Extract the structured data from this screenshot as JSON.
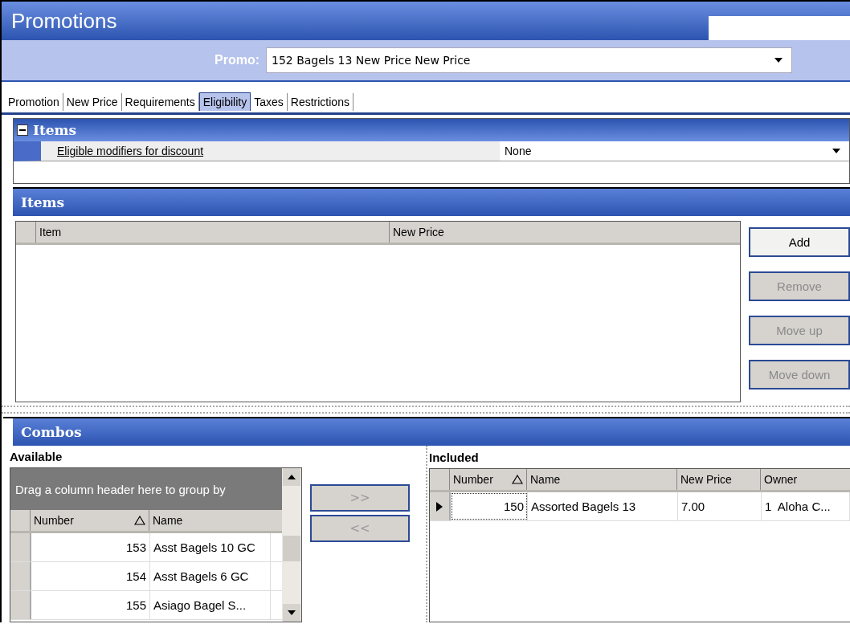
{
  "window": {
    "title": "Promotions"
  },
  "promo": {
    "label": "Promo:",
    "value": "152 Bagels 13 New Price New Price"
  },
  "tabs": [
    {
      "label": "Promotion",
      "selected": false
    },
    {
      "label": "New Price",
      "selected": false
    },
    {
      "label": "Requirements",
      "selected": false
    },
    {
      "label": "Eligibility",
      "selected": true
    },
    {
      "label": "Taxes",
      "selected": false
    },
    {
      "label": "Restrictions",
      "selected": false
    }
  ],
  "items_group": {
    "title": "Items",
    "expanded": true,
    "property": {
      "label": "Eligible modifiers for discount",
      "value": "None"
    }
  },
  "items": {
    "title": "Items",
    "columns": [
      "Item",
      "New Price"
    ],
    "buttons": [
      {
        "label": "Add",
        "disabled": false
      },
      {
        "label": "Remove",
        "disabled": true
      },
      {
        "label": "Move up",
        "disabled": true
      },
      {
        "label": "Move down",
        "disabled": true
      }
    ]
  },
  "combos": {
    "title": "Combos",
    "available": {
      "title": "Available",
      "group_hint": "Drag a column header here to group by",
      "columns": [
        "Number",
        "Name"
      ],
      "rows": [
        {
          "number": "153",
          "name": "Asst Bagels 10 GC"
        },
        {
          "number": "154",
          "name": "Asst Bagels 6 GC"
        },
        {
          "number": "155",
          "name": "Asiago Bagel S..."
        }
      ]
    },
    "move_buttons": [
      {
        "label": ">>",
        "disabled": true
      },
      {
        "label": "<<",
        "disabled": true
      }
    ],
    "included": {
      "title": "Included",
      "columns": [
        "Number",
        "Name",
        "New Price",
        "Owner"
      ],
      "rows": [
        {
          "number": "150",
          "name": "Assorted Bagels 13",
          "new_price": "7.00",
          "owner": "1  Aloha C...",
          "selected": true
        }
      ]
    }
  }
}
